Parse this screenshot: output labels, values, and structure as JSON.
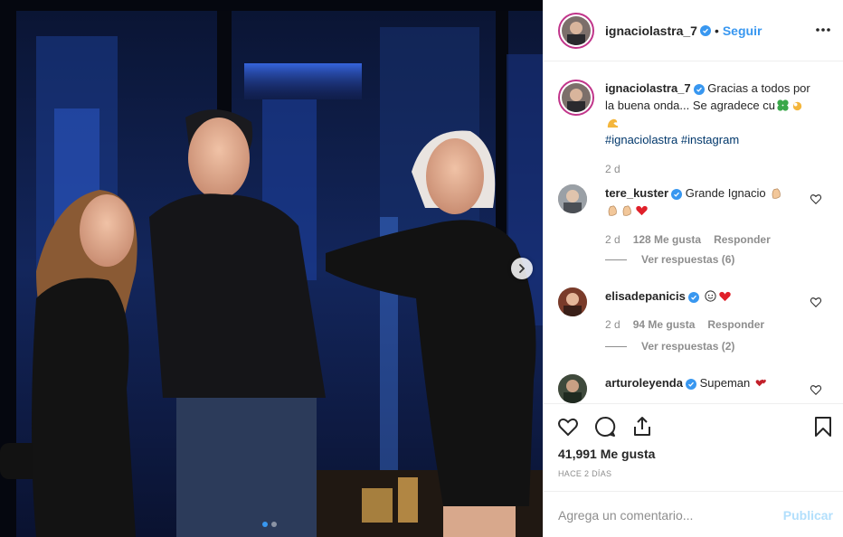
{
  "post": {
    "image": {
      "description_icon": "photo-image",
      "carousel_dots": 2,
      "active_dot": 0
    },
    "header": {
      "username": "ignaciolastra_7",
      "separator": "•",
      "follow_label": "Seguir",
      "more_icon": "more-horizontal-icon"
    },
    "caption": {
      "username": "ignaciolastra_7",
      "text": "Gracias a todos por la buena onda... Se agradece cu",
      "hashtag1": "#ignaciolastra",
      "hashtag2": "#instagram",
      "time": "2 d"
    },
    "comments": [
      {
        "username": "tere_kuster",
        "verified": true,
        "text": "Grande Ignacio",
        "time": "2 d",
        "likes": "128 Me gusta",
        "reply": "Responder",
        "replies": "Ver respuestas (6)"
      },
      {
        "username": "elisadepanicis",
        "verified": true,
        "text": "",
        "time": "2 d",
        "likes": "94 Me gusta",
        "reply": "Responder",
        "replies": "Ver respuestas (2)"
      },
      {
        "username": "arturoleyenda",
        "verified": true,
        "text": "Supeman"
      }
    ],
    "likes_count": "41,991 Me gusta",
    "posted_ago": "HACE 2 DÍAS",
    "add_comment": {
      "placeholder": "Agrega un comentario...",
      "publish_label": "Publicar"
    }
  },
  "colors": {
    "link_blue": "#3897f0",
    "hashtag": "#00376b",
    "muted": "#8e8e8e",
    "publish_disabled": "#b2dffc",
    "heart_red": "#ed4956"
  }
}
